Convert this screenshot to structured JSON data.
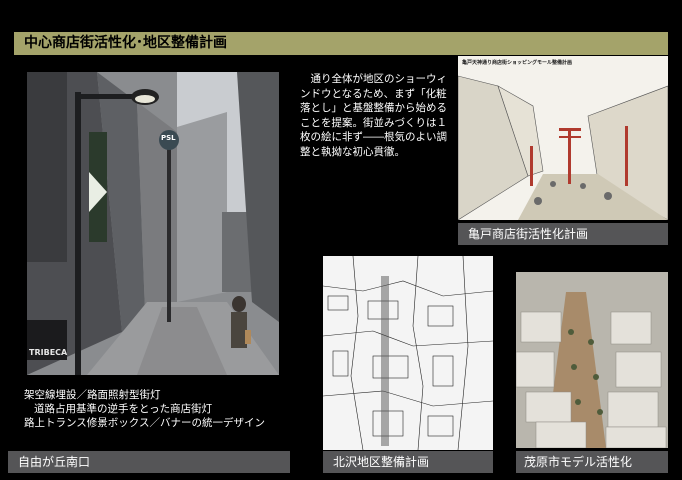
{
  "title": "中心商店街活性化･地区整備計画",
  "intro_text": "通り全体が地区のショーウィンドウとなるため、まず「化粧落とし」と基盤整備から始めることを提案。街並みづくりは１枚の絵に非ず――根気のよい調整と執拗な初心貫徹。",
  "sketch_title": "亀戸天神通り商店街ショッピングモール整備計画",
  "captions": {
    "kameido": "亀戸商店街活性化計画",
    "jiyugaoka": "自由が丘南口",
    "kitazawa": "北沢地区整備計画",
    "mobara": "茂原市モデル活性化"
  },
  "description": {
    "line1": "架空線埋設／路面照射型街灯",
    "line2": "道路占用基準の逆手をとった商店街灯",
    "line3": "路上トランス修景ボックス／バナーの統一デザイン"
  },
  "signs": {
    "shop_sign": "TRIBECA",
    "logo": "PSL"
  },
  "colors": {
    "background": "#000000",
    "title_bar": "#a4a36a",
    "caption_box": "#555557"
  }
}
